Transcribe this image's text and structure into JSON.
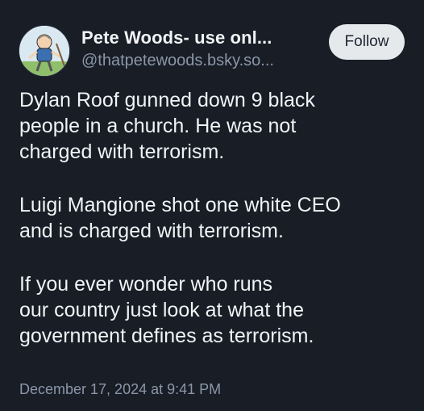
{
  "author": {
    "name": "Pete Woods- use onl...",
    "handle": "@thatpetewoods.bsky.so...",
    "avatar_icon": "cartoon-avatar-icon"
  },
  "follow_label": "Follow",
  "post": {
    "paragraphs": [
      [
        "Dylan Roof gunned down 9 black",
        "people in a church. He was not",
        "charged with terrorism."
      ],
      [
        "Luigi Mangione shot one white CEO",
        "and is charged with terrorism."
      ],
      [
        "If you ever wonder who runs",
        "our country just look at what the",
        "government defines as terrorism."
      ]
    ],
    "timestamp": "December 17, 2024 at 9:41 PM"
  },
  "colors": {
    "background": "#181d26",
    "text": "#f1f3f5",
    "muted": "#8b97a8",
    "follow_bg": "#e6e9ec"
  }
}
